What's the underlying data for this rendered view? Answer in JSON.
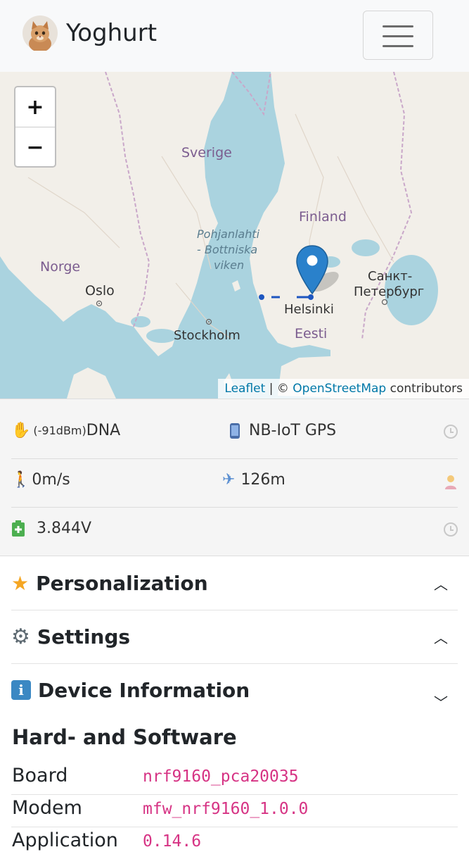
{
  "brand": {
    "name": "Yoghurt",
    "avatar_icon": "cat-avatar-icon"
  },
  "nav": {
    "menu_icon": "hamburger-menu-icon"
  },
  "map": {
    "zoom_in": "+",
    "zoom_out": "−",
    "labels": {
      "sverige": "Sverige",
      "finland": "Finland",
      "gulf1": "Pohjanlahti",
      "gulf2": "- Bottniska",
      "gulf3": "viken",
      "norge": "Norge",
      "oslo": "Oslo",
      "spb1": "Санкт-",
      "spb2": "Петербург",
      "helsinki": "Helsinki",
      "stockholm": "Stockholm",
      "eesti": "Eesti"
    },
    "attribution": {
      "leaflet": "Leaflet",
      "sep": " | © ",
      "osm": "OpenStreetMap",
      "tail": " contributors"
    }
  },
  "status": {
    "signal": {
      "icon": "waving-hand-icon",
      "dbm": "(-91dBm)",
      "operator": "DNA"
    },
    "network": {
      "icon": "mobile-phone-icon",
      "text": "NB-IoT GPS"
    },
    "speed": {
      "icon": "walking-person-icon",
      "text": "0m/s"
    },
    "altitude": {
      "icon": "airplane-icon",
      "text": "126m"
    },
    "battery": {
      "icon": "battery-icon",
      "text": "3.844V"
    }
  },
  "accordion": [
    {
      "icon": "star-icon",
      "title": "Personalization",
      "state": "collapsed"
    },
    {
      "icon": "gear-icon",
      "title": "Settings",
      "state": "collapsed"
    },
    {
      "icon": "info-icon",
      "title": "Device Information",
      "state": "expanded"
    }
  ],
  "device": {
    "heading": "Hard- and Software",
    "rows": [
      {
        "key": "Board",
        "value": "nrf9160_pca20035"
      },
      {
        "key": "Modem",
        "value": "mfw_nrf9160_1.0.0"
      },
      {
        "key": "Application",
        "value": "0.14.6"
      }
    ]
  }
}
